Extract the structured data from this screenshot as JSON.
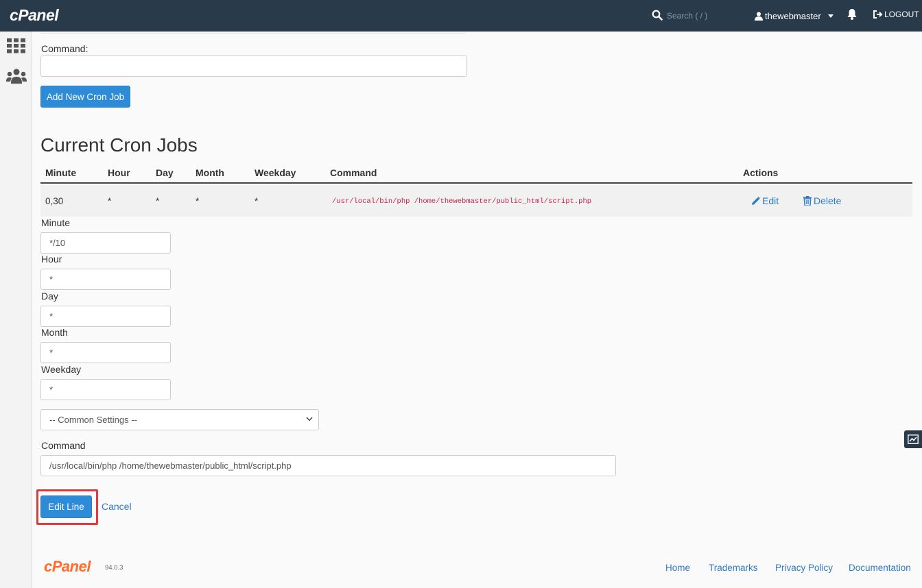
{
  "header": {
    "brand": "cPanel",
    "search_placeholder": "Search ( / )",
    "username": "thewebmaster",
    "logout_label": "LOGOUT"
  },
  "add_form": {
    "command_label": "Command:",
    "command_value": "",
    "add_button_label": "Add New Cron Job"
  },
  "cron_jobs": {
    "title": "Current Cron Jobs",
    "columns": [
      "Minute",
      "Hour",
      "Day",
      "Month",
      "Weekday",
      "Command",
      "Actions"
    ],
    "rows": [
      {
        "minute": "0,30",
        "hour": "*",
        "day": "*",
        "month": "*",
        "weekday": "*",
        "command": "/usr/local/bin/php /home/thewebmaster/public_html/script.php",
        "edit_label": "Edit",
        "delete_label": "Delete"
      }
    ]
  },
  "edit_form": {
    "minute_label": "Minute",
    "minute_value": "*/10",
    "hour_label": "Hour",
    "hour_value": "*",
    "day_label": "Day",
    "day_value": "*",
    "month_label": "Month",
    "month_value": "*",
    "weekday_label": "Weekday",
    "weekday_value": "*",
    "common_settings_selected": "-- Common Settings --",
    "command_label": "Command",
    "command_value": "/usr/local/bin/php /home/thewebmaster/public_html/script.php",
    "edit_line_label": "Edit Line",
    "cancel_label": "Cancel"
  },
  "footer": {
    "logo": "cPanel",
    "version": "94.0.3",
    "links": [
      "Home",
      "Trademarks",
      "Privacy Policy",
      "Documentation"
    ]
  },
  "colors": {
    "topbar": "#293a4a",
    "primary": "#2e8bd8",
    "link": "#2e7bc4",
    "highlight": "#e0393e",
    "code": "#c7254e",
    "brand_orange": "#ff6c2c"
  }
}
